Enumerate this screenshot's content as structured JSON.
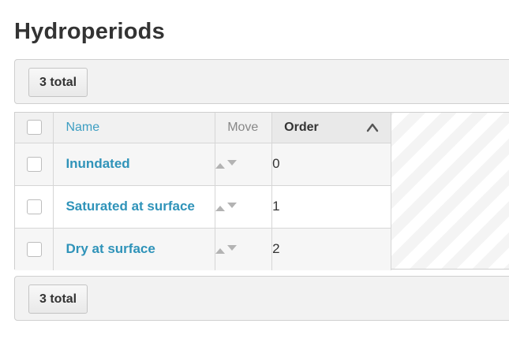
{
  "page": {
    "title": "Hydroperiods"
  },
  "toolbar_top": {
    "total_label": "3 total"
  },
  "toolbar_bottom": {
    "total_label": "3 total"
  },
  "table": {
    "columns": {
      "name": "Name",
      "move": "Move",
      "order": "Order"
    },
    "sort": {
      "column": "Order",
      "direction": "ascending",
      "icon": "chevron-up-icon"
    },
    "rows": [
      {
        "name": "Inundated",
        "order": "0"
      },
      {
        "name": "Saturated at surface",
        "order": "1"
      },
      {
        "name": "Dry at surface",
        "order": "2"
      }
    ]
  },
  "colors": {
    "link": "#2f93b9",
    "header_link": "#3d9ec2",
    "toolbar_bg": "#f2f2f2",
    "border": "#cfcfcf"
  }
}
